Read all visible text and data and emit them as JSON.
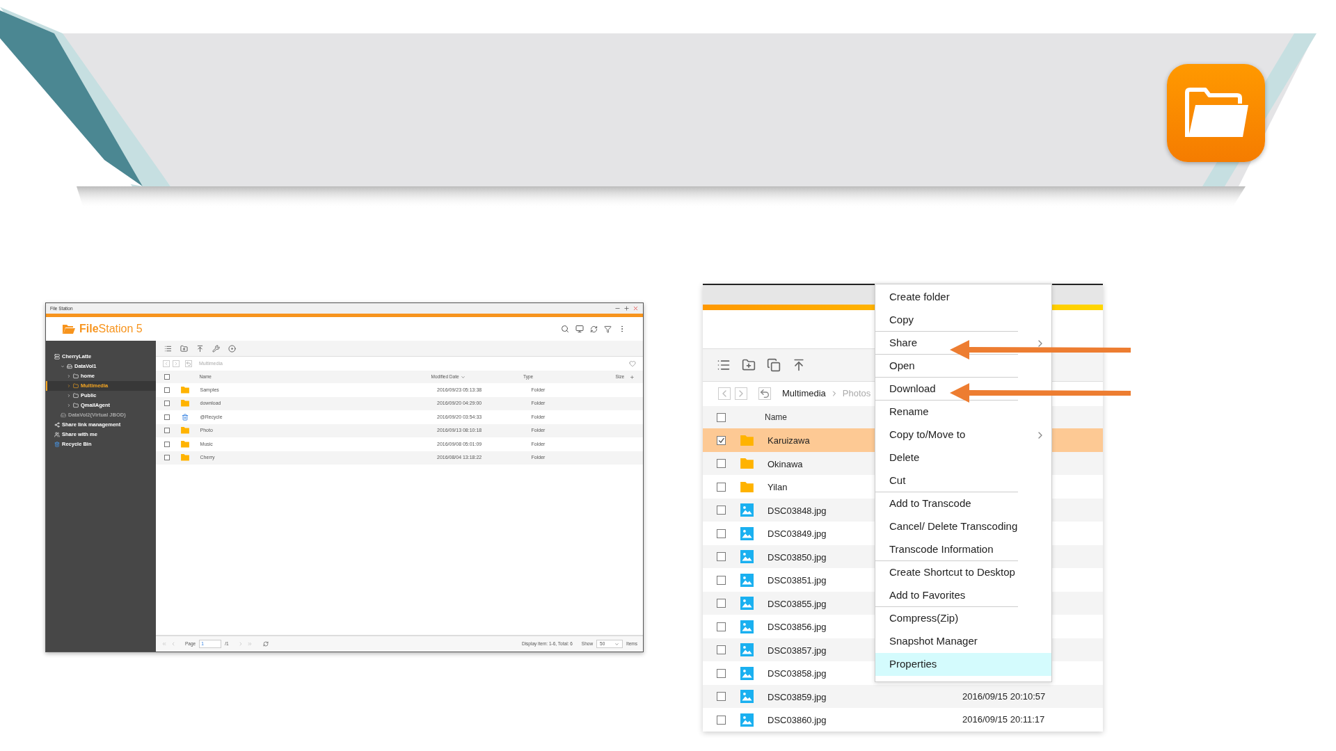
{
  "left_window": {
    "title": "File Station",
    "app_name": "**File**Station 5",
    "sidebar": {
      "items": [
        {
          "kind": "server",
          "label": "CherryLatte",
          "selected": false,
          "disabled": false,
          "children": [
            {
              "kind": "volume",
              "label": "DataVol1",
              "selected": false,
              "disabled": false,
              "expanded": true,
              "children": [
                {
                  "kind": "folder",
                  "label": "home",
                  "selected": false,
                  "disabled": false,
                  "expanded": false
                },
                {
                  "kind": "folder",
                  "label": "Multimedia",
                  "selected": true,
                  "disabled": false,
                  "expanded": false
                },
                {
                  "kind": "folder",
                  "label": "Public",
                  "selected": false,
                  "disabled": false,
                  "expanded": false
                },
                {
                  "kind": "folder",
                  "label": "QmailAgent",
                  "selected": false,
                  "disabled": false,
                  "expanded": false
                }
              ]
            },
            {
              "kind": "volume",
              "label": "DataVol2(Virtual JBOD)",
              "selected": false,
              "disabled": true
            }
          ]
        },
        {
          "kind": "share_link",
          "label": "Share link management",
          "selected": false,
          "disabled": false
        },
        {
          "kind": "shared",
          "label": "Share with me",
          "selected": false,
          "disabled": false
        },
        {
          "kind": "recycle",
          "label": "Recycle Bin",
          "selected": false,
          "disabled": false
        }
      ]
    },
    "breadcrumb": [
      "Multimedia"
    ],
    "table": {
      "select_all": {
        "checked": false
      },
      "columns": [
        {
          "label": "Name",
          "sorted": false
        },
        {
          "label": "Modified Date",
          "sorted": true
        },
        {
          "label": "Type",
          "sorted": false
        },
        {
          "label": "Size",
          "sorted": false
        }
      ],
      "rows": [
        {
          "kind": "folder",
          "name": "Samples",
          "date": "2016/09/23 05:13:38",
          "type": "Folder",
          "checked": false
        },
        {
          "kind": "folder",
          "name": "download",
          "date": "2016/09/20 04:29:00",
          "type": "Folder",
          "checked": false
        },
        {
          "kind": "recycle_bin",
          "name": "@Recycle",
          "date": "2016/09/20 03:54:33",
          "type": "Folder",
          "checked": false
        },
        {
          "kind": "folder",
          "name": "Photo",
          "date": "2016/09/13 08:10:18",
          "type": "Folder",
          "checked": false
        },
        {
          "kind": "folder",
          "name": "Music",
          "date": "2016/09/08 05:01:09",
          "type": "Folder",
          "checked": false
        },
        {
          "kind": "folder",
          "name": "Cherry",
          "date": "2016/08/04 13:18:22",
          "type": "Folder",
          "checked": false
        }
      ]
    },
    "footer": {
      "page_label": "Page",
      "page": "1",
      "page_total": "/1",
      "display": "Display item: 1-6, Total: 6",
      "show_label": "Show",
      "show": "50",
      "items_label": "Items"
    }
  },
  "right_window": {
    "breadcrumb": [
      "Multimedia",
      "Photos"
    ],
    "select_all": {
      "checked": false
    },
    "columns": [
      "Name"
    ],
    "rows": [
      {
        "kind": "folder",
        "name": "Karuizawa",
        "checked": true,
        "selected": true
      },
      {
        "kind": "folder",
        "name": "Okinawa",
        "checked": false,
        "selected": false
      },
      {
        "kind": "folder",
        "name": "Yilan",
        "checked": false,
        "selected": false
      },
      {
        "kind": "image",
        "name": "DSC03848.jpg",
        "checked": false,
        "selected": false
      },
      {
        "kind": "image",
        "name": "DSC03849.jpg",
        "checked": false,
        "selected": false
      },
      {
        "kind": "image",
        "name": "DSC03850.jpg",
        "checked": false,
        "selected": false
      },
      {
        "kind": "image",
        "name": "DSC03851.jpg",
        "checked": false,
        "selected": false
      },
      {
        "kind": "image",
        "name": "DSC03855.jpg",
        "checked": false,
        "selected": false
      },
      {
        "kind": "image",
        "name": "DSC03856.jpg",
        "checked": false,
        "selected": false
      },
      {
        "kind": "image",
        "name": "DSC03857.jpg",
        "checked": false,
        "selected": false
      },
      {
        "kind": "image",
        "name": "DSC03858.jpg",
        "checked": false,
        "selected": false
      },
      {
        "kind": "image",
        "name": "DSC03859.jpg",
        "checked": false,
        "selected": false,
        "date": "2016/09/15 20:10:57"
      },
      {
        "kind": "image",
        "name": "DSC03860.jpg",
        "checked": false,
        "selected": false,
        "date": "2016/09/15 20:11:17"
      }
    ],
    "context_menu": [
      {
        "label": "Create folder",
        "submenu": false,
        "separator_after": false,
        "selected": false
      },
      {
        "label": "Copy",
        "submenu": false,
        "separator_after": true,
        "selected": false
      },
      {
        "label": "Share",
        "submenu": true,
        "separator_after": true,
        "selected": false
      },
      {
        "label": "Open",
        "submenu": false,
        "separator_after": true,
        "selected": false
      },
      {
        "label": "Download",
        "submenu": false,
        "separator_after": true,
        "selected": false
      },
      {
        "label": "Rename",
        "submenu": false,
        "separator_after": false,
        "selected": false
      },
      {
        "label": "Copy to/Move to",
        "submenu": true,
        "separator_after": false,
        "selected": false
      },
      {
        "label": "Delete",
        "submenu": false,
        "separator_after": false,
        "selected": false
      },
      {
        "label": "Cut",
        "submenu": false,
        "separator_after": true,
        "selected": false
      },
      {
        "label": "Add to Transcode",
        "submenu": false,
        "separator_after": false,
        "selected": false
      },
      {
        "label": "Cancel/ Delete Transcoding",
        "submenu": false,
        "separator_after": false,
        "selected": false
      },
      {
        "label": "Transcode Information",
        "submenu": false,
        "separator_after": true,
        "selected": false
      },
      {
        "label": "Create Shortcut to Desktop",
        "submenu": false,
        "separator_after": false,
        "selected": false
      },
      {
        "label": "Add to Favorites",
        "submenu": false,
        "separator_after": true,
        "selected": false
      },
      {
        "label": "Compress(Zip)",
        "submenu": false,
        "separator_after": false,
        "selected": false
      },
      {
        "label": "Snapshot Manager",
        "submenu": false,
        "separator_after": false,
        "selected": false
      },
      {
        "label": "Properties",
        "submenu": false,
        "separator_after": false,
        "selected": true
      }
    ]
  }
}
